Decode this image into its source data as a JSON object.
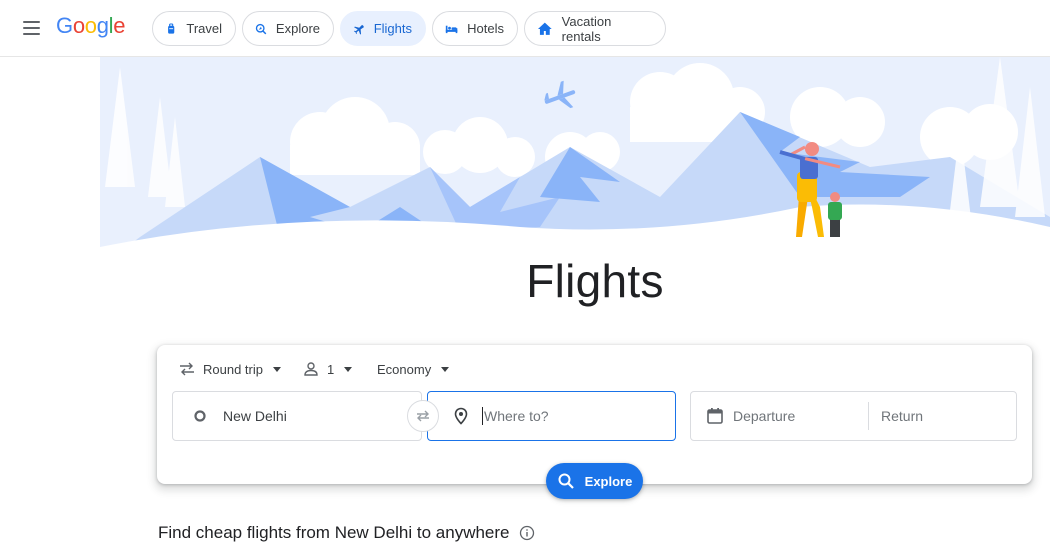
{
  "header": {
    "logo_text": "Google",
    "nav_chips": [
      {
        "label": "Travel",
        "icon": "travel-bag-icon"
      },
      {
        "label": "Explore",
        "icon": "explore-icon"
      },
      {
        "label": "Flights",
        "icon": "airplane-icon",
        "active": true
      },
      {
        "label": "Hotels",
        "icon": "bed-icon"
      },
      {
        "label": "Vacation rentals",
        "icon": "house-icon"
      }
    ]
  },
  "hero": {
    "title": "Flights"
  },
  "search": {
    "trip_type": "Round trip",
    "passengers": "1",
    "cabin_class": "Economy",
    "origin_value": "New Delhi",
    "destination_placeholder": "Where to?",
    "departure_placeholder": "Departure",
    "return_placeholder": "Return",
    "explore_label": "Explore"
  },
  "section": {
    "heading": "Find cheap flights from New Delhi to anywhere"
  },
  "colors": {
    "accent": "#1a73e8",
    "active_chip_bg": "#e8f0fe",
    "active_chip_text": "#1967d2"
  }
}
